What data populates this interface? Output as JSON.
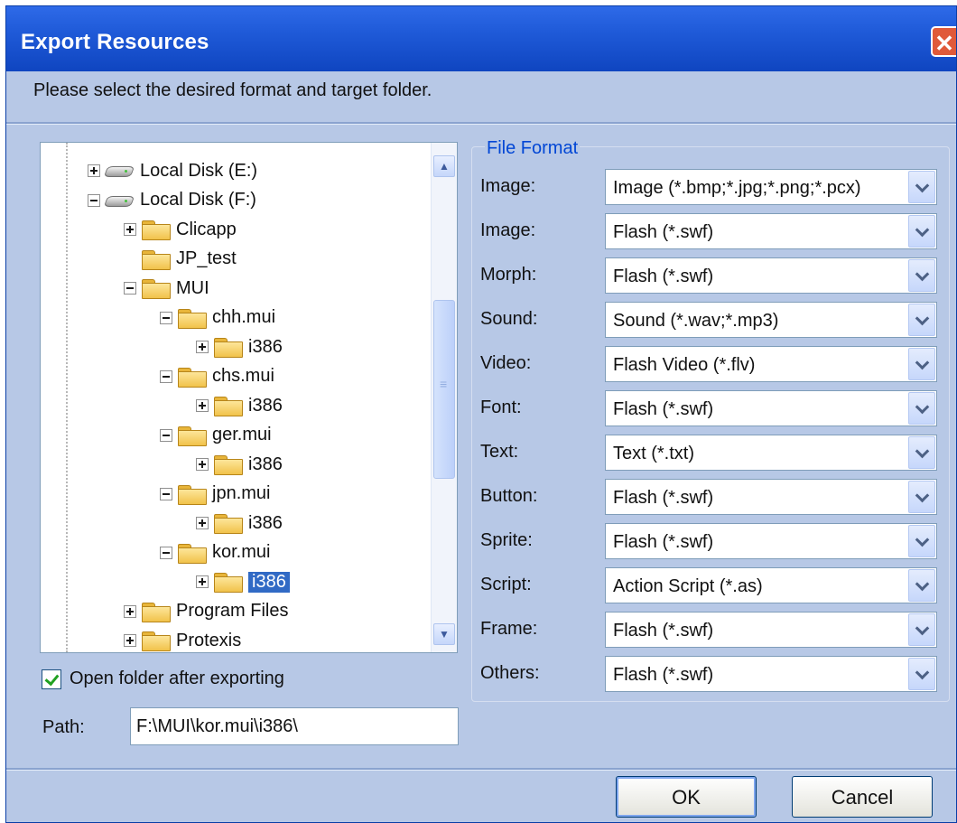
{
  "window": {
    "title": "Export Resources",
    "close_glyph": "✕"
  },
  "instruction": "Please select the desired format and target folder.",
  "tree": {
    "items": [
      {
        "label": "Local Disk (E:)",
        "type": "disk",
        "expander": "plus",
        "selected": false
      },
      {
        "label": "Local Disk (F:)",
        "type": "disk",
        "expander": "minus",
        "selected": false
      },
      {
        "label": "Clicapp",
        "type": "folder",
        "expander": "plus",
        "selected": false
      },
      {
        "label": "JP_test",
        "type": "folder",
        "expander": "none",
        "selected": false
      },
      {
        "label": "MUI",
        "type": "folder",
        "expander": "minus",
        "selected": false
      },
      {
        "label": "chh.mui",
        "type": "folder",
        "expander": "minus",
        "selected": false
      },
      {
        "label": "i386",
        "type": "folder",
        "expander": "plus",
        "selected": false
      },
      {
        "label": "chs.mui",
        "type": "folder",
        "expander": "minus",
        "selected": false
      },
      {
        "label": "i386",
        "type": "folder",
        "expander": "plus",
        "selected": false
      },
      {
        "label": "ger.mui",
        "type": "folder",
        "expander": "minus",
        "selected": false
      },
      {
        "label": "i386",
        "type": "folder",
        "expander": "plus",
        "selected": false
      },
      {
        "label": "jpn.mui",
        "type": "folder",
        "expander": "minus",
        "selected": false
      },
      {
        "label": "i386",
        "type": "folder",
        "expander": "plus",
        "selected": false
      },
      {
        "label": "kor.mui",
        "type": "folder",
        "expander": "minus",
        "selected": false
      },
      {
        "label": "i386",
        "type": "folder",
        "expander": "plus",
        "selected": true
      },
      {
        "label": "Program Files",
        "type": "folder",
        "expander": "plus",
        "selected": false
      },
      {
        "label": "Protexis",
        "type": "folder",
        "expander": "plus",
        "selected": false
      }
    ]
  },
  "file_format": {
    "group_title": "File Format",
    "rows": [
      {
        "label": "Image:",
        "value": "Image (*.bmp;*.jpg;*.png;*.pcx)"
      },
      {
        "label": "Image:",
        "value": "Flash (*.swf)"
      },
      {
        "label": "Morph:",
        "value": "Flash (*.swf)"
      },
      {
        "label": "Sound:",
        "value": "Sound (*.wav;*.mp3)"
      },
      {
        "label": "Video:",
        "value": "Flash Video (*.flv)"
      },
      {
        "label": "Font:",
        "value": "Flash (*.swf)"
      },
      {
        "label": "Text:",
        "value": "Text (*.txt)"
      },
      {
        "label": "Button:",
        "value": "Flash (*.swf)"
      },
      {
        "label": "Sprite:",
        "value": "Flash (*.swf)"
      },
      {
        "label": "Script:",
        "value": "Action Script (*.as)"
      },
      {
        "label": "Frame:",
        "value": "Flash (*.swf)"
      },
      {
        "label": "Others:",
        "value": "Flash (*.swf)"
      }
    ]
  },
  "open_folder": {
    "label": "Open folder after exporting",
    "checked": true
  },
  "path": {
    "label": "Path:",
    "value": "F:\\MUI\\kor.mui\\i386\\"
  },
  "buttons": {
    "ok": "OK",
    "cancel": "Cancel"
  },
  "colors": {
    "title_bar": "#1f5ad8",
    "dialog_bg": "#b7c8e6",
    "selection": "#316ac5",
    "group_title": "#0046d5",
    "close_button": "#e05a3a"
  }
}
